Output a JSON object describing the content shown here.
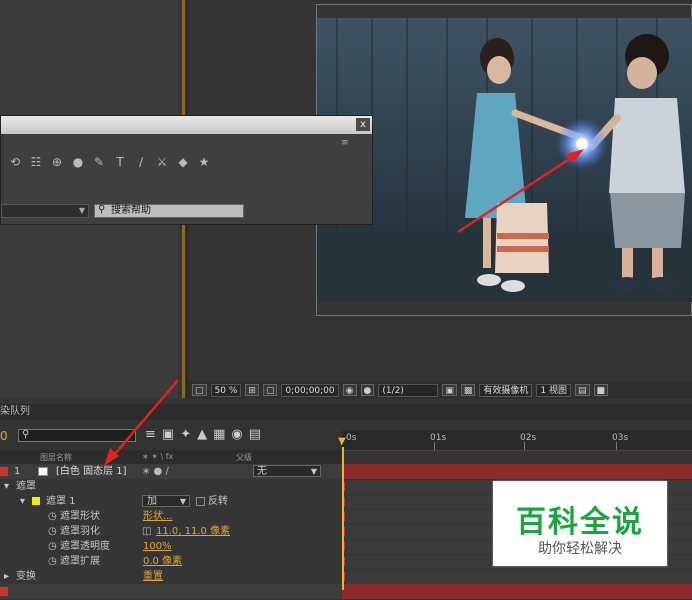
{
  "tools_window": {
    "close_label": "x",
    "menu_glyph": "≡",
    "tools": [
      "⟲",
      "☷",
      "⊕",
      "●",
      "✎",
      "T",
      "∕",
      "⚔",
      "◆",
      "★"
    ],
    "search_placeholder": "搜索帮助"
  },
  "viewer": {
    "zoom": "50 %",
    "timecode": "0;00;00;00",
    "resolution": "(1/2)",
    "camera": "有效摄像机",
    "views": "1 视图"
  },
  "timeline": {
    "tab_label": "染队列",
    "timecode": "0",
    "ruler_labels": [
      "0s",
      "01s",
      "02s",
      "03s"
    ],
    "col_layer_name": "图层名称",
    "col_switches": "∗ ✶ \\ fx",
    "col_parent": "父级",
    "layer1": {
      "index": "1",
      "name": "[白色 固态层 1]",
      "parent_value": "无"
    },
    "masks_group": "遮罩",
    "mask1": {
      "name": "遮罩 1",
      "mode": "加",
      "invert_label": "反转"
    },
    "props": [
      {
        "name": "遮罩形状",
        "value": "形状..."
      },
      {
        "name": "遮罩羽化",
        "value": "11.0, 11.0 像素"
      },
      {
        "name": "遮罩透明度",
        "value": "100%"
      },
      {
        "name": "遮罩扩展",
        "value": "0.0 像素"
      }
    ],
    "transform_label": "变换",
    "transform_reset": "重置"
  },
  "watermark": {
    "title": "百科全说",
    "subtitle": "助你轻松解决"
  },
  "colors": {
    "accent_orange": "#d8a93a",
    "red_keyframe": "#cc3333",
    "watermark_green": "#1aa53f"
  }
}
